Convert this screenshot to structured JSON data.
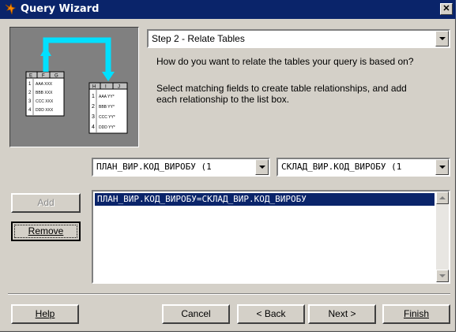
{
  "window": {
    "title": "Query Wizard",
    "close_glyph": "✕"
  },
  "step_select": {
    "value": "Step 2 - Relate Tables"
  },
  "instructions": {
    "line1": "How do you want to relate the tables your query is based on?",
    "line2a": "Select matching fields to create table relationships, and add",
    "line2b": "each relationship to the list box."
  },
  "fields": {
    "left": "ПЛАН_ВИР.КОД_ВИРОБУ  (1",
    "right": "СКЛАД_ВИР.КОД_ВИРОБУ  (1"
  },
  "relationships": {
    "items": [
      "ПЛАН_ВИР.КОД_ВИРОБУ=СКЛАД_ВИР.КОД_ВИРОБУ"
    ]
  },
  "buttons": {
    "add": "Add",
    "remove": "Remove",
    "help": "Help",
    "cancel": "Cancel",
    "back": "< Back",
    "next": "Next >",
    "finish": "Finish"
  },
  "illustration": {
    "left_table": {
      "headers": [
        "E",
        "F",
        "G"
      ],
      "rows": [
        [
          "1",
          "AAA XXX"
        ],
        [
          "2",
          "BBB XXX"
        ],
        [
          "3",
          "CCC XXX"
        ],
        [
          "4",
          "DDD XXX"
        ]
      ]
    },
    "right_table": {
      "headers": [
        "H",
        "I",
        "J"
      ],
      "rows": [
        [
          "1",
          "AAA YY*"
        ],
        [
          "2",
          "BBB YY*"
        ],
        [
          "3",
          "CCC YY*"
        ],
        [
          "4",
          "DDD YY*"
        ]
      ]
    }
  },
  "colors": {
    "titlebar": "#0a246a",
    "face": "#d4d0c8",
    "arrow": "#00ffff",
    "selection": "#0a246a"
  }
}
